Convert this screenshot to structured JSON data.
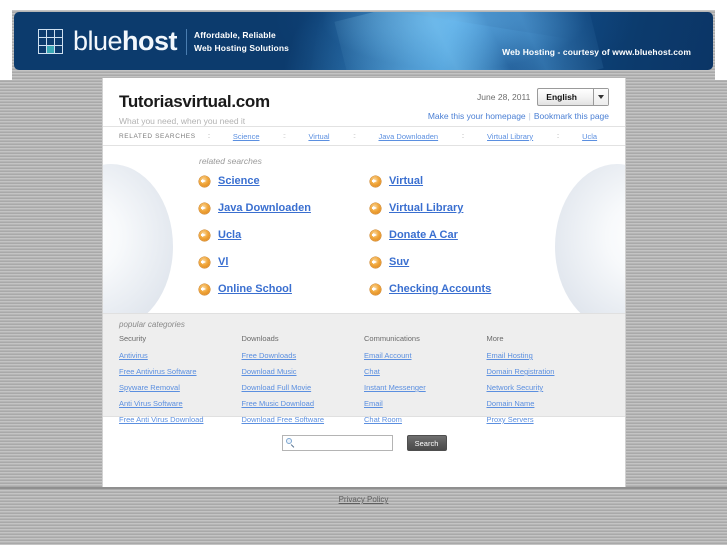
{
  "banner": {
    "logo_text_light": "blue",
    "logo_text_bold": "host",
    "tagline_line1": "Affordable, Reliable",
    "tagline_line2": "Web Hosting Solutions",
    "right_text": "Web Hosting - courtesy of www.bluehost.com",
    "brand_color": "#0c3b6d",
    "accent_color": "#3ba9b5"
  },
  "site": {
    "title": "Tutoriasvirtual.com",
    "subtitle": "What you need, when you need it",
    "date": "June 28, 2011",
    "language": "English",
    "homepage_link": "Make this your homepage",
    "bookmark_link": "Bookmark this page",
    "separator": "|"
  },
  "related_strip": {
    "label": "RELATED SEARCHES",
    "dot": "::",
    "items": [
      "Science",
      "Virtual",
      "Java Downloaden",
      "Virtual Library",
      "Ucla"
    ]
  },
  "related_searches": {
    "title": "related searches",
    "left_column": [
      "Science",
      "Java Downloaden",
      "Ucla",
      "Vl",
      "Online School"
    ],
    "right_column": [
      "Virtual",
      "Virtual Library",
      "Donate A Car",
      "Suv",
      "Checking Accounts"
    ],
    "bullet_icon": "arrow-circle-icon",
    "link_color": "#3a6fd0",
    "bullet_color": "#f0a63a"
  },
  "popular_categories": {
    "title": "popular categories",
    "columns": [
      {
        "heading": "Security",
        "links": [
          "Antivirus",
          "Free Antivirus Software",
          "Spyware Removal",
          "Anti Virus Software",
          "Free Anti Virus Download"
        ]
      },
      {
        "heading": "Downloads",
        "links": [
          "Free Downloads",
          "Download Music",
          "Download Full Movie",
          "Free Music Download",
          "Download Free Software"
        ]
      },
      {
        "heading": "Communications",
        "links": [
          "Email Account",
          "Chat",
          "Instant Messenger",
          "Email",
          "Chat Room"
        ]
      },
      {
        "heading": "More",
        "links": [
          "Email Hosting",
          "Domain Registration",
          "Network Security",
          "Domain Name",
          "Proxy Servers"
        ]
      }
    ]
  },
  "search": {
    "value": "",
    "placeholder": "",
    "button_label": "Search",
    "icon": "magnifier-icon"
  },
  "footer": {
    "privacy_link": "Privacy Policy"
  }
}
